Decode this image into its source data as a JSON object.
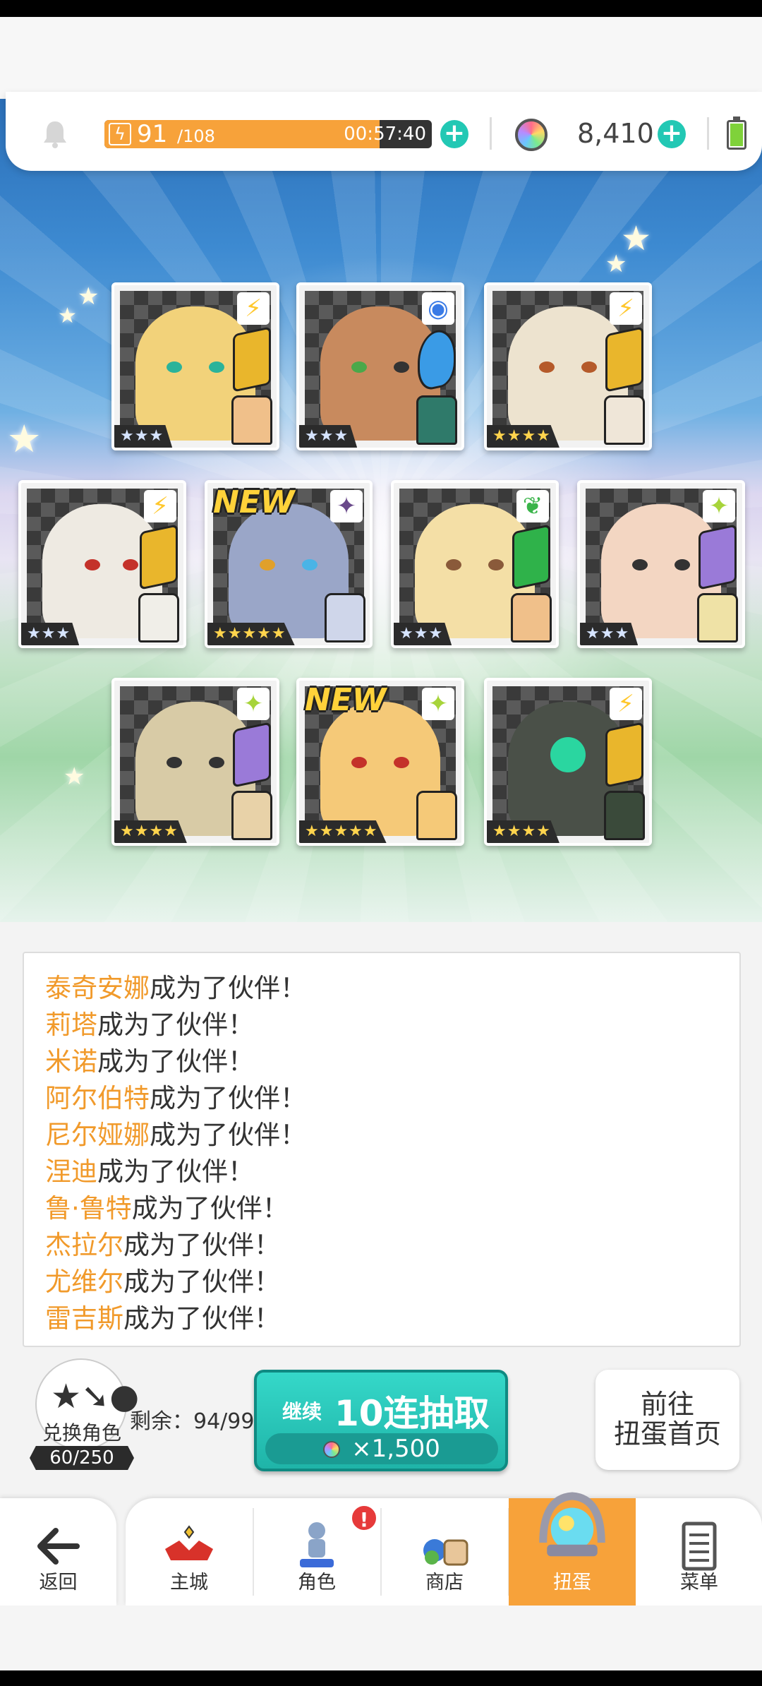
{
  "header": {
    "energy_current": "91",
    "energy_max": "/108",
    "energy_fill": 0.84,
    "energy_timer": "00:57:40",
    "gem_count": "8,410",
    "plus_glyph": "+",
    "icons": [
      "bell-icon",
      "lightning-icon",
      "plus-icon",
      "gem-icon",
      "battery-icon"
    ]
  },
  "cards": [
    {
      "stars": "★★★",
      "element": "⚡",
      "new_label": ""
    },
    {
      "stars": "★★★",
      "element": "◉",
      "new_label": ""
    },
    {
      "stars": "★★★★",
      "element": "⚡",
      "new_label": ""
    },
    {
      "stars": "★★★",
      "element": "⚡",
      "new_label": ""
    },
    {
      "stars": "★★★★★",
      "element": "✦",
      "new_label": "NEW"
    },
    {
      "stars": "★★★",
      "element": "❦",
      "new_label": ""
    },
    {
      "stars": "★★★",
      "element": "✦",
      "new_label": ""
    },
    {
      "stars": "★★★★",
      "element": "✦",
      "new_label": ""
    },
    {
      "stars": "★★★★★",
      "element": "✦",
      "new_label": "NEW"
    },
    {
      "stars": "★★★★",
      "element": "⚡",
      "new_label": ""
    }
  ],
  "log": [
    {
      "name": "泰奇安娜",
      "suffix": "成为了伙伴！"
    },
    {
      "name": "莉塔",
      "suffix": "成为了伙伴！"
    },
    {
      "name": "米诺",
      "suffix": "成为了伙伴！"
    },
    {
      "name": "阿尔伯特",
      "suffix": "成为了伙伴！"
    },
    {
      "name": "尼尔娅娜",
      "suffix": "成为了伙伴！"
    },
    {
      "name": "涅迪",
      "suffix": "成为了伙伴！"
    },
    {
      "name": "鲁·鲁特",
      "suffix": "成为了伙伴！"
    },
    {
      "name": "杰拉尔",
      "suffix": "成为了伙伴！"
    },
    {
      "name": "尤维尔",
      "suffix": "成为了伙伴！"
    },
    {
      "name": "雷吉斯",
      "suffix": "成为了伙伴！"
    }
  ],
  "exchange": {
    "label": "兑换角色",
    "count": "60/250"
  },
  "remaining": "剩余：94/99",
  "pull_button": {
    "continue": "继续",
    "label": "10连抽取",
    "cost": "×1,500"
  },
  "goto_button": {
    "line1": "前往",
    "line2": "扭蛋首页"
  },
  "nav": {
    "back": "返回",
    "items": [
      "主城",
      "角色",
      "商店",
      "扭蛋",
      "菜单"
    ],
    "alert": "!"
  },
  "colors": {
    "accent_orange": "#f7a23a",
    "teal": "#22c8b4",
    "hero_name": "#f19a2b"
  }
}
